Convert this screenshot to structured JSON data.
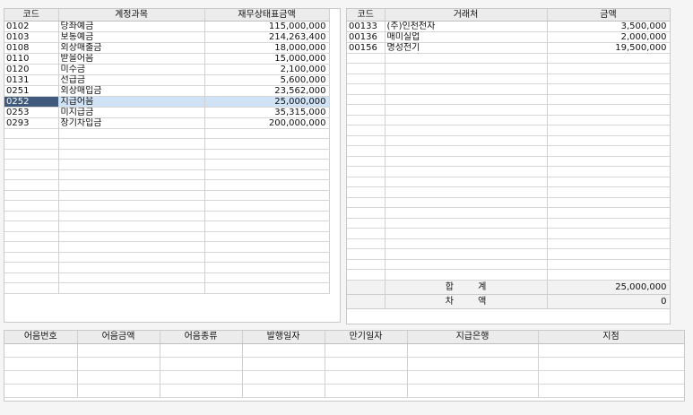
{
  "account_table": {
    "headers": {
      "code": "코드",
      "account": "계정과목",
      "amount": "재무상태표금액"
    },
    "rows": [
      {
        "code": "0102",
        "account": "당좌예금",
        "amount": "115,000,000"
      },
      {
        "code": "0103",
        "account": "보통예금",
        "amount": "214,263,400"
      },
      {
        "code": "0108",
        "account": "외상매출금",
        "amount": "18,000,000"
      },
      {
        "code": "0110",
        "account": "받을어음",
        "amount": "15,000,000"
      },
      {
        "code": "0120",
        "account": "미수금",
        "amount": "2,100,000"
      },
      {
        "code": "0131",
        "account": "선급금",
        "amount": "5,600,000"
      },
      {
        "code": "0251",
        "account": "외상매입금",
        "amount": "23,562,000"
      },
      {
        "code": "0252",
        "account": "지급어음",
        "amount": "25,000,000",
        "selected": true
      },
      {
        "code": "0253",
        "account": "미지급금",
        "amount": "35,315,000"
      },
      {
        "code": "0293",
        "account": "장기차입금",
        "amount": "200,000,000"
      }
    ]
  },
  "vendor_table": {
    "headers": {
      "code": "코드",
      "vendor": "거래처",
      "amount": "금액"
    },
    "rows": [
      {
        "code": "00133",
        "vendor": "(주)인천전자",
        "amount": "3,500,000"
      },
      {
        "code": "00136",
        "vendor": "매미실업",
        "amount": "2,000,000"
      },
      {
        "code": "00156",
        "vendor": "명성전기",
        "amount": "19,500,000"
      }
    ],
    "total_label": "합 계",
    "total_value": "25,000,000",
    "diff_label": "차 액",
    "diff_value": "0"
  },
  "note_table": {
    "headers": {
      "note_no": "어음번호",
      "note_amount": "어음금액",
      "note_type": "어음종류",
      "issue_date": "발행일자",
      "due_date": "만기일자",
      "pay_bank": "지급은행",
      "branch": "지점"
    }
  }
}
